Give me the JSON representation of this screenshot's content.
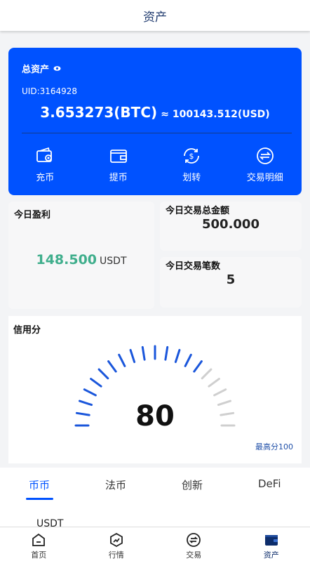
{
  "header": {
    "title": "资产"
  },
  "asset_card": {
    "title": "总资产",
    "uid": "UID:3164928",
    "btc_balance": "3.653273(BTC)",
    "usd_balance": "≈ 100143.512(USD)",
    "actions": [
      {
        "label": "充币",
        "icon": "deposit-icon"
      },
      {
        "label": "提币",
        "icon": "withdraw-icon"
      },
      {
        "label": "划转",
        "icon": "transfer-icon"
      },
      {
        "label": "交易明细",
        "icon": "transaction-details-icon"
      }
    ]
  },
  "stats": {
    "profit_label": "今日盈利",
    "profit_value": "148.500",
    "profit_unit": "USDT",
    "total_amount_label": "今日交易总金额",
    "total_amount_value": "500.000",
    "trade_count_label": "今日交易笔数",
    "trade_count_value": "5"
  },
  "credit": {
    "label": "信用分",
    "score": "80",
    "score_fraction": 0.8,
    "max_label": "最高分100"
  },
  "tabs": [
    {
      "label": "币币",
      "active": true
    },
    {
      "label": "法币",
      "active": false
    },
    {
      "label": "创新",
      "active": false
    },
    {
      "label": "DeFi",
      "active": false
    }
  ],
  "list_peek": "USDT",
  "bottom_nav": [
    {
      "label": "首页",
      "icon": "home-icon"
    },
    {
      "label": "行情",
      "icon": "market-icon"
    },
    {
      "label": "交易",
      "icon": "trade-icon"
    },
    {
      "label": "资产",
      "icon": "wallet-icon",
      "active": true
    }
  ],
  "colors": {
    "primary": "#0052ff",
    "profit": "#3fae8c",
    "gauge_active": "#1a56db",
    "gauge_inactive": "#cfcfcf"
  }
}
